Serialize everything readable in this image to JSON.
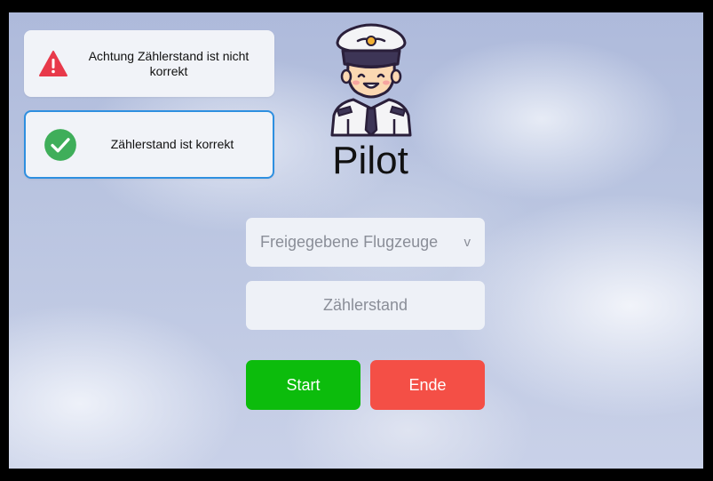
{
  "notifications": {
    "warning": {
      "text": "Achtung Zählerstand ist nicht korrekt",
      "color": "#e8394a"
    },
    "success": {
      "text": "Zählerstand ist korrekt",
      "color": "#3fae5a"
    }
  },
  "header": {
    "title": "Pilot"
  },
  "form": {
    "aircraft_select": {
      "value": "Freigegebene Flugzeuge",
      "caret": "v"
    },
    "counter_input": {
      "placeholder": "Zählerstand"
    }
  },
  "buttons": {
    "start_label": "Start",
    "start_color": "#0cbc0c",
    "end_label": "Ende",
    "end_color": "#f44f46"
  }
}
